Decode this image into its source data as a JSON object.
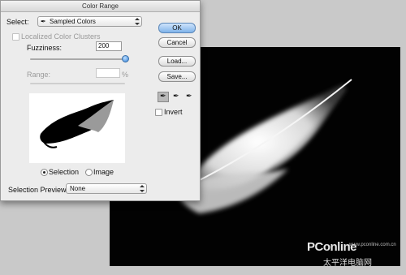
{
  "dialog": {
    "title": "Color Range",
    "select_label": "Select:",
    "select_value": "Sampled Colors",
    "localized_label": "Localized Color Clusters",
    "fuzziness_label": "Fuzziness:",
    "fuzziness_value": "200",
    "fuzziness_fraction": 1.0,
    "range_label": "Range:",
    "range_value": "",
    "range_unit": "%",
    "radio_selection": "Selection",
    "radio_image": "Image",
    "preview_label": "Selection Preview:",
    "preview_value": "None",
    "buttons": {
      "ok": "OK",
      "cancel": "Cancel",
      "load": "Load...",
      "save": "Save..."
    },
    "invert_label": "Invert"
  },
  "watermark": {
    "brand": "PConline",
    "sub": "太平洋电脑网",
    "url": "www.pconline.com.cn"
  },
  "colors": {
    "accent": "#2f7fd8",
    "canvas_bg": "#020202",
    "window_bg": "#ececec"
  }
}
